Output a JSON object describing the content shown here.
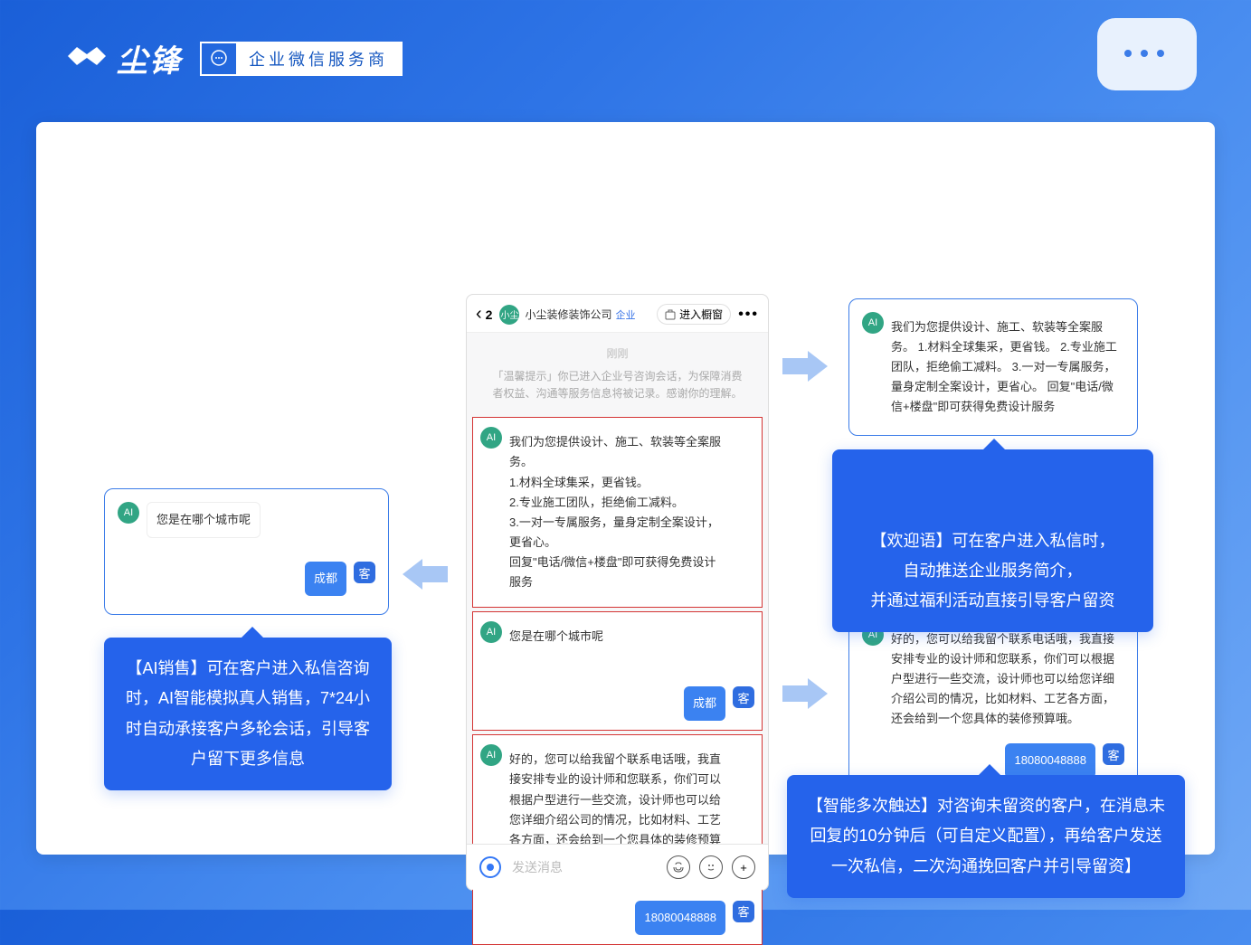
{
  "header": {
    "brand_name": "尘锋",
    "badge_label": "企业微信服务商"
  },
  "phone": {
    "back_count": "2",
    "avatar_text": "小尘",
    "company_name": "小尘装修装饰公司",
    "enterprise_tag": "企业",
    "orange_btn_label": "进入橱窗",
    "time_label": "刚刚",
    "notice_text": "「温馨提示」你已进入企业号咨询会话，为保障消费者权益、沟通等服务信息将被记录。感谢你的理解。",
    "input_placeholder": "发送消息"
  },
  "ai_label": "AI",
  "customer_label": "客",
  "messages": {
    "welcome": "我们为您提供设计、施工、软装等全案服务。\n1.材料全球集采，更省钱。\n2.专业施工团队，拒绝偷工减料。\n3.一对一专属服务，量身定制全案设计，更省心。\n回复\"电话/微信+楼盘\"即可获得免费设计服务",
    "city_question": "您是在哪个城市呢",
    "city_answer": "成都",
    "followup": "好的，您可以给我留个联系电话哦，我直接安排专业的设计师和您联系，你们可以根据户型进行一些交流，设计师也可以给您详细介绍公司的情况，比如材料、工艺各方面，还会给到一个您具体的装修预算哦。",
    "phone_number": "18080048888"
  },
  "info_boxes": {
    "left": "【AI销售】可在客户进入私信咨询时，AI智能模拟真人销售，7*24小时自动承接客户多轮会话，引导客户留下更多信息",
    "right_top": "【欢迎语】可在客户进入私信时，\n自动推送企业服务简介，\n并通过福利活动直接引导客户留资",
    "right_bottom": "【智能多次触达】对咨询未留资的客户，在消息未回复的10分钟后（可自定义配置），再给客户发送一次私信，二次沟通挽回客户并引导留资】"
  }
}
